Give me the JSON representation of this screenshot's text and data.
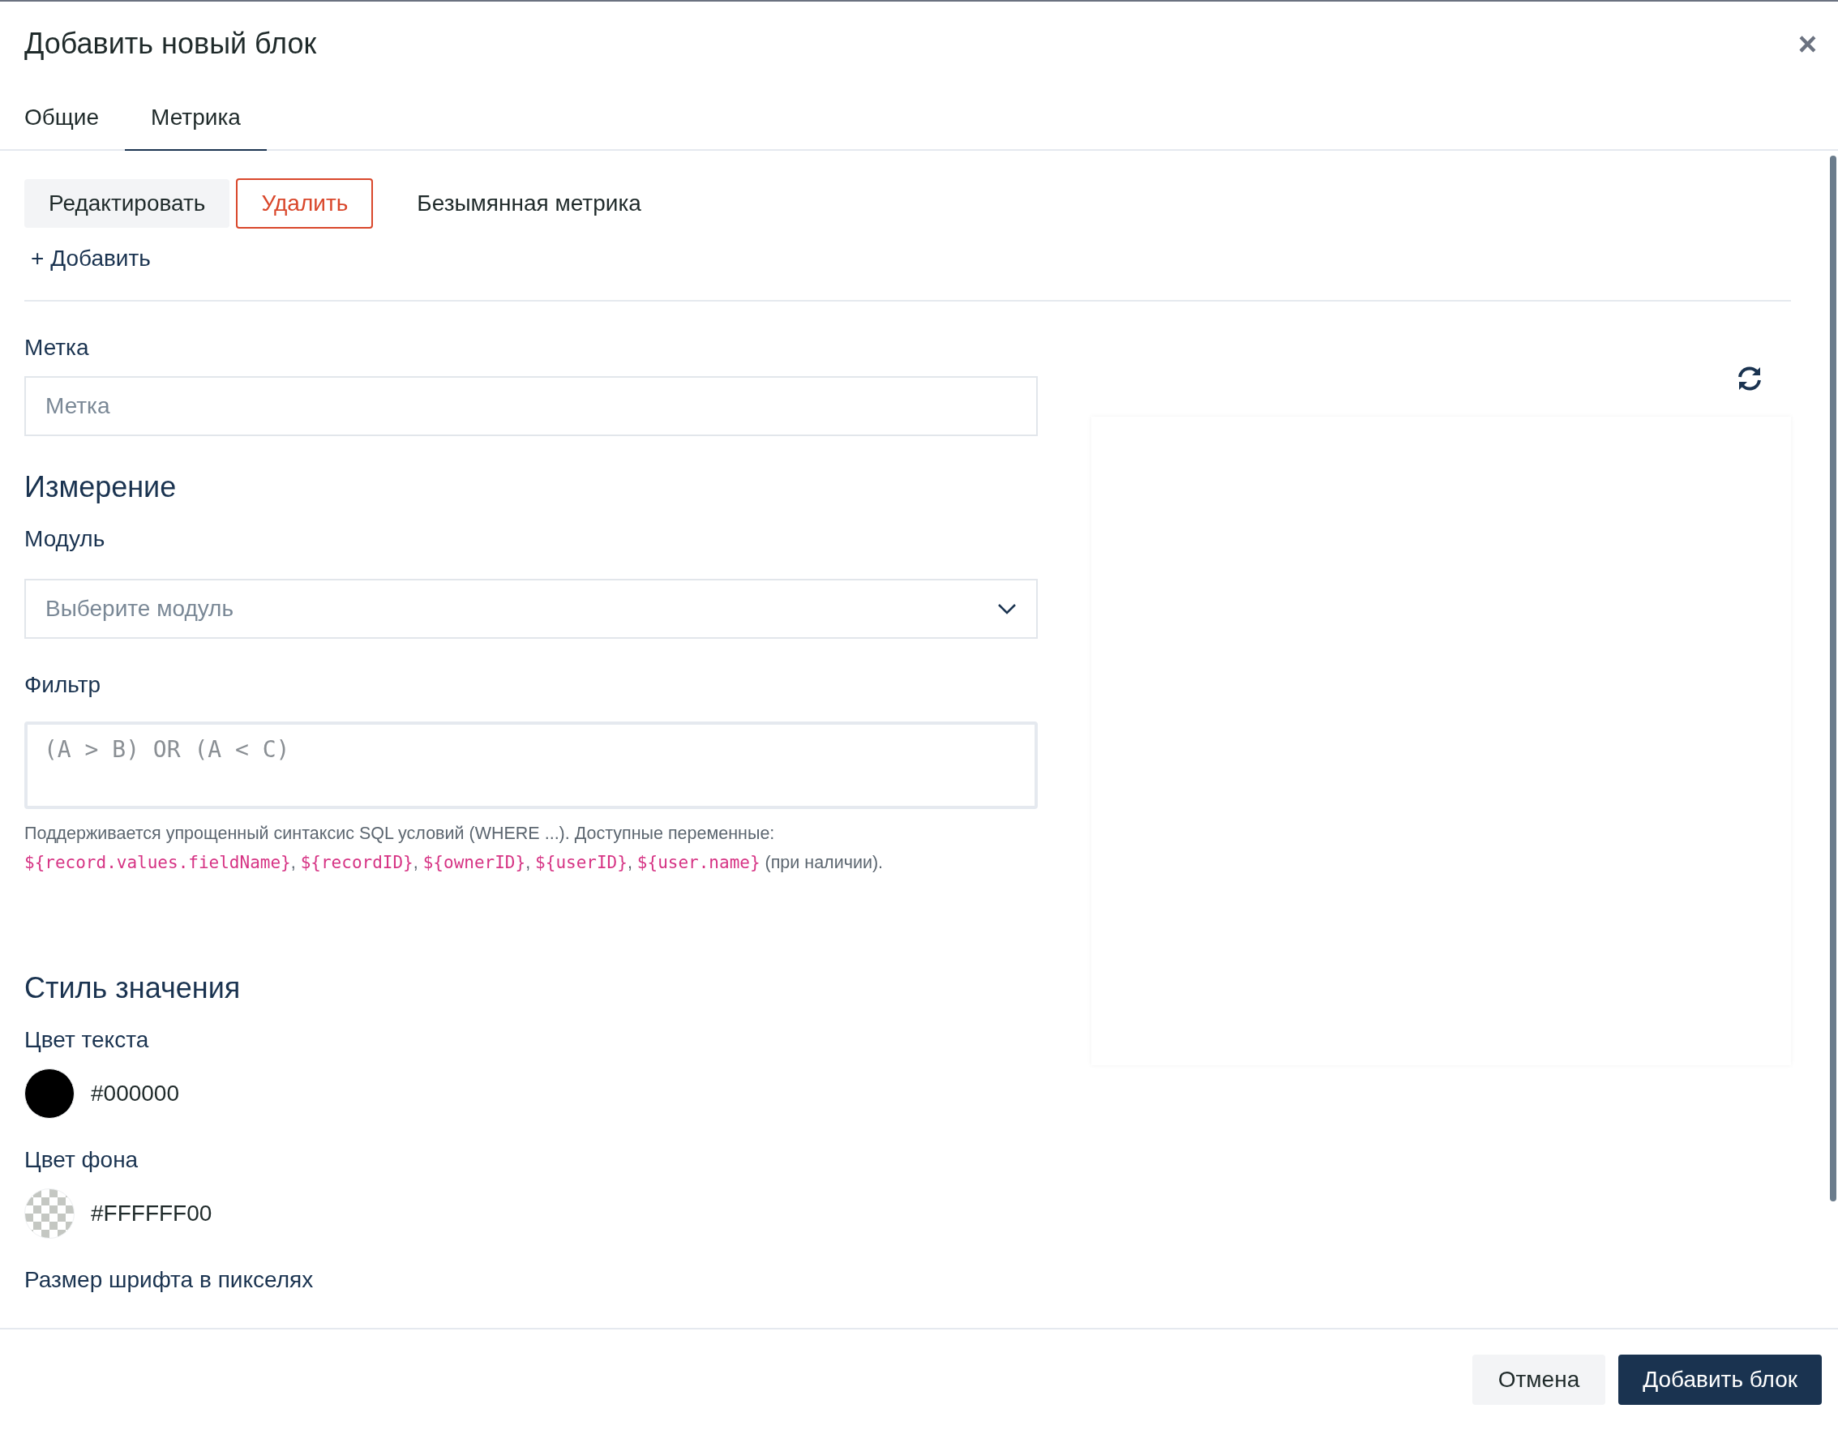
{
  "dialog": {
    "title": "Добавить новый блок",
    "close": "×"
  },
  "tabs": [
    {
      "label": "Общие",
      "selected": false
    },
    {
      "label": "Метрика",
      "selected": true
    }
  ],
  "metric_bar": {
    "edit": "Редактировать",
    "delete": "Удалить",
    "metric_name": "Безымянная метрика",
    "add": "+ Добавить"
  },
  "label_field": {
    "label": "Метка",
    "placeholder": "Метка"
  },
  "dimension": {
    "heading": "Измерение",
    "module_label": "Модуль",
    "module_placeholder": "Выберите модуль",
    "filter_label": "Фильтр",
    "filter_placeholder": "(A > B) OR (A < C)",
    "help": [
      {
        "kind": "text",
        "text": "Поддерживается упрощенный синтаксис SQL условий (WHERE ...). Доступные переменные:"
      },
      {
        "kind": "break"
      },
      {
        "kind": "code",
        "text": "${record.values.fieldName}"
      },
      {
        "kind": "text",
        "text": ", "
      },
      {
        "kind": "code",
        "text": "${recordID}"
      },
      {
        "kind": "text",
        "text": ", "
      },
      {
        "kind": "code",
        "text": "${ownerID}"
      },
      {
        "kind": "text",
        "text": ", "
      },
      {
        "kind": "code",
        "text": "${userID}"
      },
      {
        "kind": "text",
        "text": ", "
      },
      {
        "kind": "code",
        "text": "${user.name}"
      },
      {
        "kind": "text",
        "text": " (при наличии)."
      }
    ]
  },
  "value_style": {
    "heading": "Стиль значения",
    "colors": [
      {
        "label": "Цвет текста",
        "kind": "solid",
        "color": "#000000",
        "value": "#000000"
      },
      {
        "label": "Цвет фона",
        "kind": "transparent",
        "value": "#FFFFFF00"
      }
    ],
    "font_size_label": "Размер шрифта в пикселях"
  },
  "footer": {
    "cancel": "Отмена",
    "submit": "Добавить блок"
  }
}
